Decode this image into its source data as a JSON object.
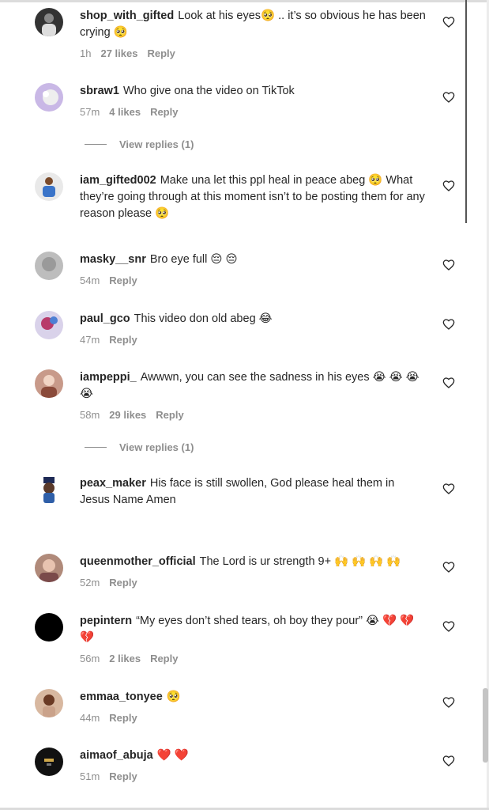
{
  "comments": [
    {
      "username": "shop_with_gifted",
      "text": "Look at his eyes🥺 .. it’s so obvious he has been crying 🥺",
      "time": "1h",
      "likes": "27 likes",
      "reply": "Reply"
    },
    {
      "username": "sbraw1",
      "text": "Who give ona the video on TikTok",
      "time": "57m",
      "likes": "4 likes",
      "reply": "Reply",
      "view_replies": "View replies (1)"
    },
    {
      "username": "iam_gifted002",
      "text": "Make una let this ppl heal in peace abeg 🥺 What they’re going through at this moment isn’t to be posting them for any reason please 🥺"
    },
    {
      "username": "masky__snr",
      "text": "Bro eye full 😔 😔",
      "time": "54m",
      "reply": "Reply"
    },
    {
      "username": "paul_gco",
      "text": "This video don old abeg 😂",
      "time": "47m",
      "reply": "Reply"
    },
    {
      "username": "iampeppi_",
      "text": "Awwwn, you can see the sadness in his eyes 😭 😭 😭 😭",
      "time": "58m",
      "likes": "29 likes",
      "reply": "Reply",
      "view_replies": "View replies (1)"
    },
    {
      "username": "peax_maker",
      "text": "His face is still swollen, God please heal them in Jesus Name Amen"
    },
    {
      "username": "queenmother_official",
      "text": "The Lord is ur strength 9+ 🙌 🙌 🙌 🙌",
      "time": "52m",
      "reply": "Reply"
    },
    {
      "username": "pepintern",
      "text": "“My eyes don’t shed tears, oh boy they pour” 😭 💔 💔 💔",
      "time": "56m",
      "likes": "2 likes",
      "reply": "Reply"
    },
    {
      "username": "emmaa_tonyee",
      "text": "🥺",
      "time": "44m",
      "reply": "Reply"
    },
    {
      "username": "aimaof_abuja",
      "text": "❤️ ❤️",
      "time": "51m",
      "reply": "Reply"
    }
  ],
  "icons": {
    "like": "heart-outline-icon"
  },
  "colors": {
    "text": "#262626",
    "muted": "#8e8e8e",
    "background": "#ffffff"
  }
}
